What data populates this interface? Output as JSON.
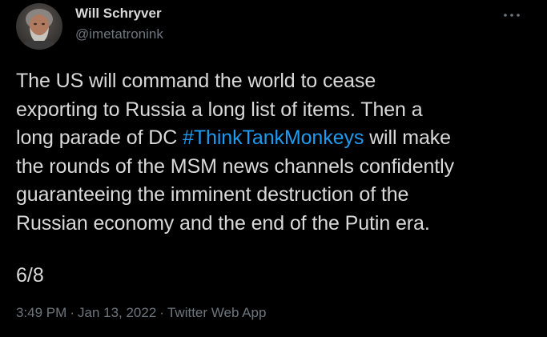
{
  "tweet": {
    "author": {
      "display_name": "Will Schryver",
      "handle": "@imetatronink"
    },
    "more_icon": "more-horizontal-icon",
    "text": {
      "line1": "The US will command the world to cease",
      "line2": "exporting to Russia a long list of items. Then a",
      "line3_pre": "long parade of DC ",
      "line3_hashtag": "#ThinkTankMonkeys",
      "line3_post": " will make",
      "line4": "the rounds of the MSM news channels confidently",
      "line5": "guaranteeing the imminent destruction of the",
      "line6": "Russian economy and the end of the Putin era."
    },
    "counter": "6/8",
    "meta": {
      "time": "3:49 PM",
      "separator": "·",
      "date": "Jan 13, 2022",
      "source": "Twitter Web App"
    }
  },
  "colors": {
    "background": "#000000",
    "text": "#d9d9d9",
    "secondary": "#6e767d",
    "link": "#1d9bf0"
  }
}
